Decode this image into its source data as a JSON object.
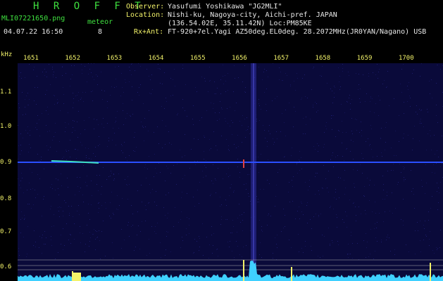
{
  "header": {
    "app_title": "H R O F F T",
    "filename": "MLI07221650.png",
    "mode": "meteor",
    "datetime": "04.07.22 16:50",
    "count": "8",
    "observer_label": "Observer:",
    "observer": "Yasufumi Yoshikawa \"JG2MLI\"",
    "location_label": "Location:",
    "location": "Nishi-ku, Nagoya-city, Aichi-pref. JAPAN",
    "coords": "(136.54.02E, 35.11.42N) Loc:PM85KE",
    "rx_label": "Rx+Ant:",
    "rx": "FT-920+7el.Yagi AZ50deg.EL0deg. 28.2072MHz(JR0YAN/Nagano) USB"
  },
  "axes": {
    "y_unit": "kHz",
    "y_ticks": [
      "1.1",
      "1.0",
      "0.9",
      "0.8",
      "0.7",
      "0.6"
    ],
    "x_ticks": [
      "1651",
      "1652",
      "1653",
      "1654",
      "1655",
      "1656",
      "1657",
      "1658",
      "1659",
      "1700"
    ]
  },
  "colors": {
    "background": "#0a0a3a",
    "carrier": "#2a4fff",
    "spectrum": "#3fd0ff",
    "signal": "#f3f36a"
  }
}
